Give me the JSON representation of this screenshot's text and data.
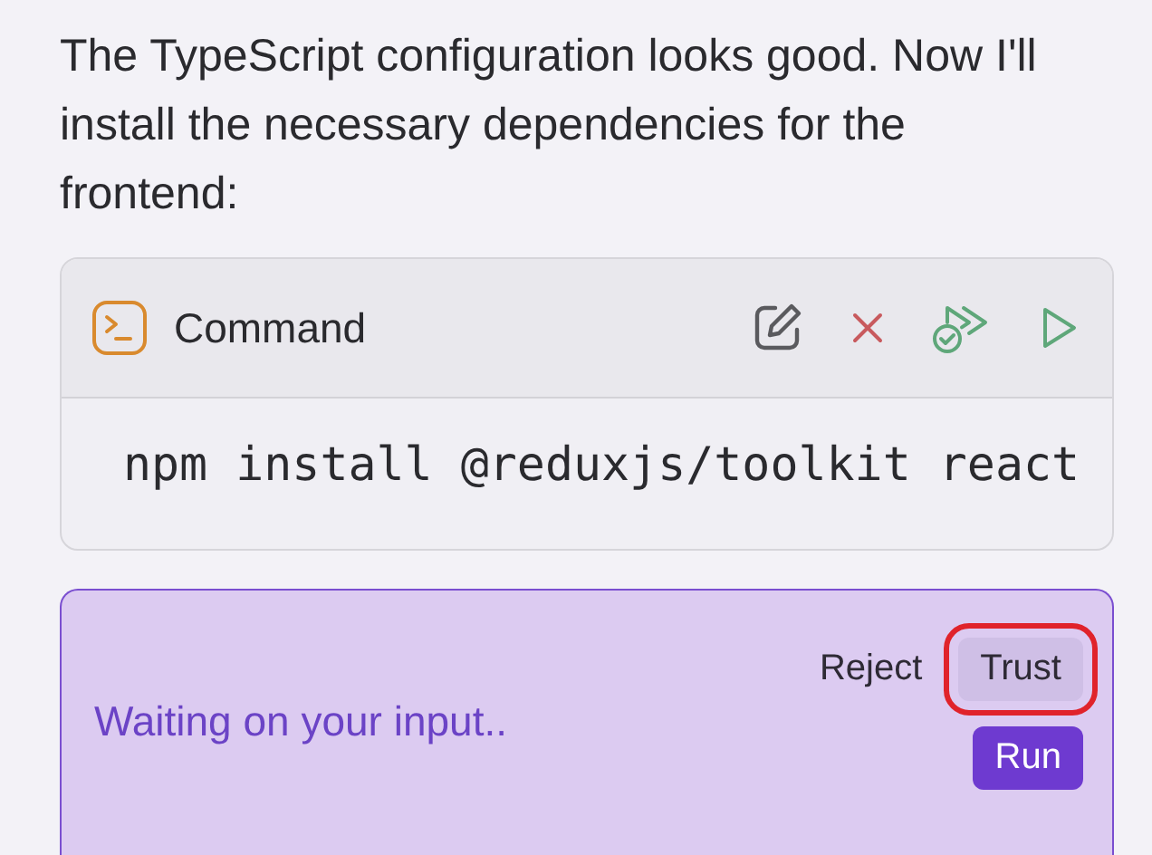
{
  "message": "The TypeScript configuration looks good. Now I'll install the necessary dependencies for the frontend:",
  "command_card": {
    "title": "Command",
    "command": "npm install @reduxjs/toolkit react"
  },
  "approval": {
    "status": "Waiting on your input..",
    "buttons": [
      {
        "label": "Reject",
        "kind": "text",
        "highlighted": false
      },
      {
        "label": "Trust",
        "kind": "secondary",
        "highlighted": true
      },
      {
        "label": "Run",
        "kind": "primary",
        "highlighted": false
      }
    ]
  }
}
